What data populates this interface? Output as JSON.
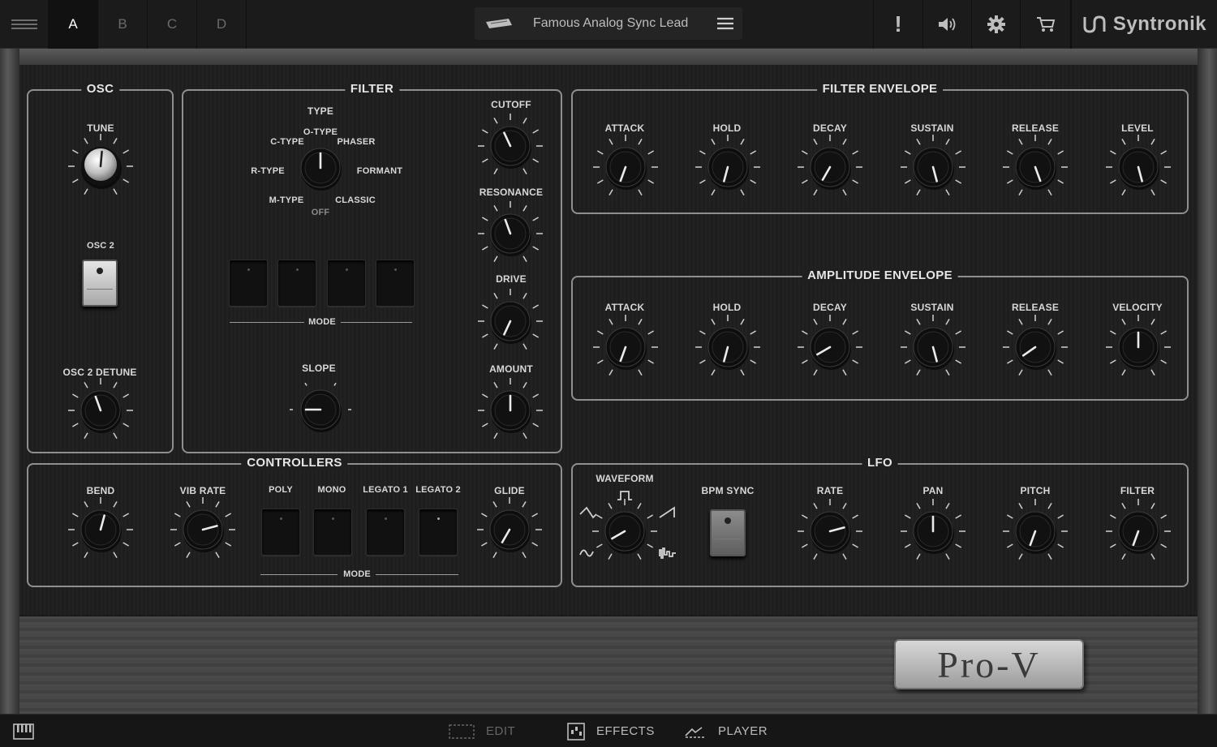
{
  "topbar": {
    "slots": [
      "A",
      "B",
      "C",
      "D"
    ],
    "active_slot": "A",
    "preset_name": "Famous Analog Sync Lead",
    "alert": "!",
    "brand": "Syntronik"
  },
  "osc": {
    "title": "OSC",
    "tune": "TUNE",
    "osc2": "OSC 2",
    "osc2_detune": "OSC 2 DETUNE"
  },
  "filter": {
    "title": "FILTER",
    "type": "TYPE",
    "type_options": {
      "o_type": "O-TYPE",
      "c_type": "C-TYPE",
      "phaser": "PHASER",
      "r_type": "R-TYPE",
      "formant": "FORMANT",
      "m_type": "M-TYPE",
      "classic": "CLASSIC",
      "off": "OFF"
    },
    "mode": "MODE",
    "slope": "SLOPE",
    "cutoff": "CUTOFF",
    "resonance": "RESONANCE",
    "drive": "DRIVE",
    "amount": "AMOUNT"
  },
  "filter_env": {
    "title": "FILTER ENVELOPE",
    "knobs": [
      "ATTACK",
      "HOLD",
      "DECAY",
      "SUSTAIN",
      "RELEASE",
      "LEVEL"
    ]
  },
  "amp_env": {
    "title": "AMPLITUDE ENVELOPE",
    "knobs": [
      "ATTACK",
      "HOLD",
      "DECAY",
      "SUSTAIN",
      "RELEASE",
      "VELOCITY"
    ]
  },
  "controllers": {
    "title": "CONTROLLERS",
    "bend": "BEND",
    "vib_rate": "VIB RATE",
    "modes": [
      "POLY",
      "MONO",
      "LEGATO 1",
      "LEGATO 2"
    ],
    "mode": "MODE",
    "glide": "GLIDE"
  },
  "lfo": {
    "title": "LFO",
    "waveform": "WAVEFORM",
    "bpm_sync": "BPM SYNC",
    "rate": "RATE",
    "pan": "PAN",
    "pitch": "PITCH",
    "filter": "FILTER"
  },
  "badge": "Pro-V",
  "bottombar": {
    "edit": "EDIT",
    "effects": "EFFECTS",
    "player": "PLAYER"
  }
}
